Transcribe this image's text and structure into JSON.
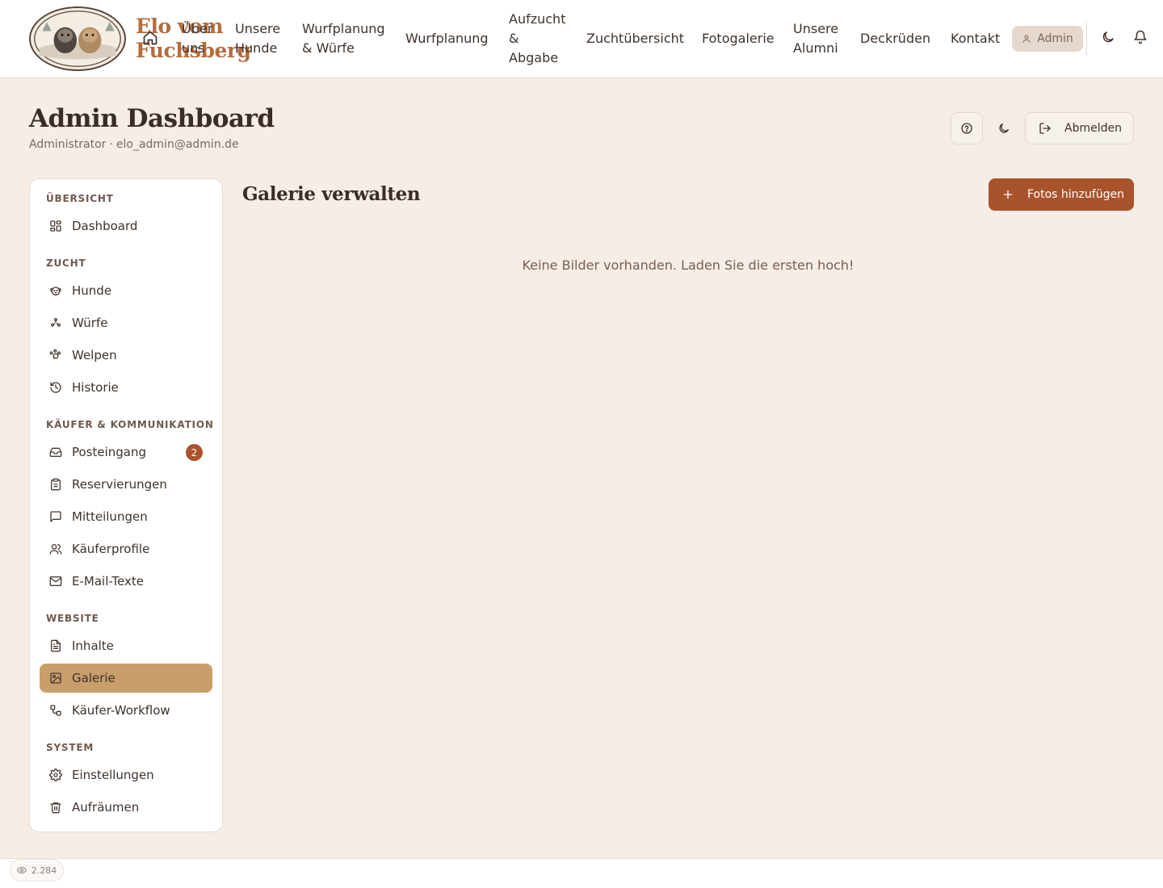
{
  "header": {
    "brand_line1": "Elo vom",
    "brand_line2": "Fuchsberg",
    "nav": [
      {
        "line1": "Über",
        "line2": "uns",
        "line3": ""
      },
      {
        "line1": "Unsere",
        "line2": "Hunde",
        "line3": ""
      },
      {
        "line1": "Wurfplanung",
        "line2": "& Würfe",
        "line3": ""
      },
      {
        "line1": "Wurfplanung",
        "line2": "",
        "line3": ""
      },
      {
        "line1": "Aufzucht",
        "line2": "&",
        "line3": "Abgabe"
      },
      {
        "line1": "Zuchtübersicht",
        "line2": "",
        "line3": ""
      },
      {
        "line1": "Fotogalerie",
        "line2": "",
        "line3": ""
      },
      {
        "line1": "Unsere",
        "line2": "Alumni",
        "line3": ""
      },
      {
        "line1": "Deckrüden",
        "line2": "",
        "line3": ""
      },
      {
        "line1": "Kontakt",
        "line2": "",
        "line3": ""
      }
    ],
    "admin_label": "Admin",
    "icons": {
      "home": "home-icon",
      "theme": "moon-icon",
      "notifications": "bell-icon"
    }
  },
  "page": {
    "title": "Admin Dashboard",
    "role": "Administrator",
    "separator": "·",
    "email": "elo_admin@admin.de",
    "logout_label": "Abmelden"
  },
  "sidebar": {
    "sections": [
      {
        "title": "ÜBERSICHT",
        "items": [
          {
            "label": "Dashboard",
            "icon": "dashboard-icon"
          }
        ]
      },
      {
        "title": "ZUCHT",
        "items": [
          {
            "label": "Hunde",
            "icon": "dog-icon"
          },
          {
            "label": "Würfe",
            "icon": "litter-icon"
          },
          {
            "label": "Welpen",
            "icon": "paw-icon"
          },
          {
            "label": "Historie",
            "icon": "history-icon"
          }
        ]
      },
      {
        "title": "KÄUFER & KOMMUNIKATION",
        "items": [
          {
            "label": "Posteingang",
            "icon": "inbox-icon",
            "badge": "2"
          },
          {
            "label": "Reservierungen",
            "icon": "clipboard-icon"
          },
          {
            "label": "Mitteilungen",
            "icon": "message-icon"
          },
          {
            "label": "Käuferprofile",
            "icon": "users-icon"
          },
          {
            "label": "E-Mail-Texte",
            "icon": "mail-icon"
          }
        ]
      },
      {
        "title": "WEBSITE",
        "items": [
          {
            "label": "Inhalte",
            "icon": "document-icon"
          },
          {
            "label": "Galerie",
            "icon": "image-icon",
            "active": true
          },
          {
            "label": "Käufer-Workflow",
            "icon": "workflow-icon"
          }
        ]
      },
      {
        "title": "SYSTEM",
        "items": [
          {
            "label": "Einstellungen",
            "icon": "gear-icon"
          },
          {
            "label": "Aufräumen",
            "icon": "trash-icon"
          }
        ]
      }
    ]
  },
  "main": {
    "title": "Galerie verwalten",
    "add_button": "Fotos hinzufügen",
    "empty_message": "Keine Bilder vorhanden. Laden Sie die ersten hoch!"
  },
  "footer": {
    "view_count": "2.284"
  },
  "colors": {
    "accent": "#a8532c",
    "active_item": "#c99e6c",
    "brand_text": "#b56c3e",
    "background": "#f5ede6"
  }
}
